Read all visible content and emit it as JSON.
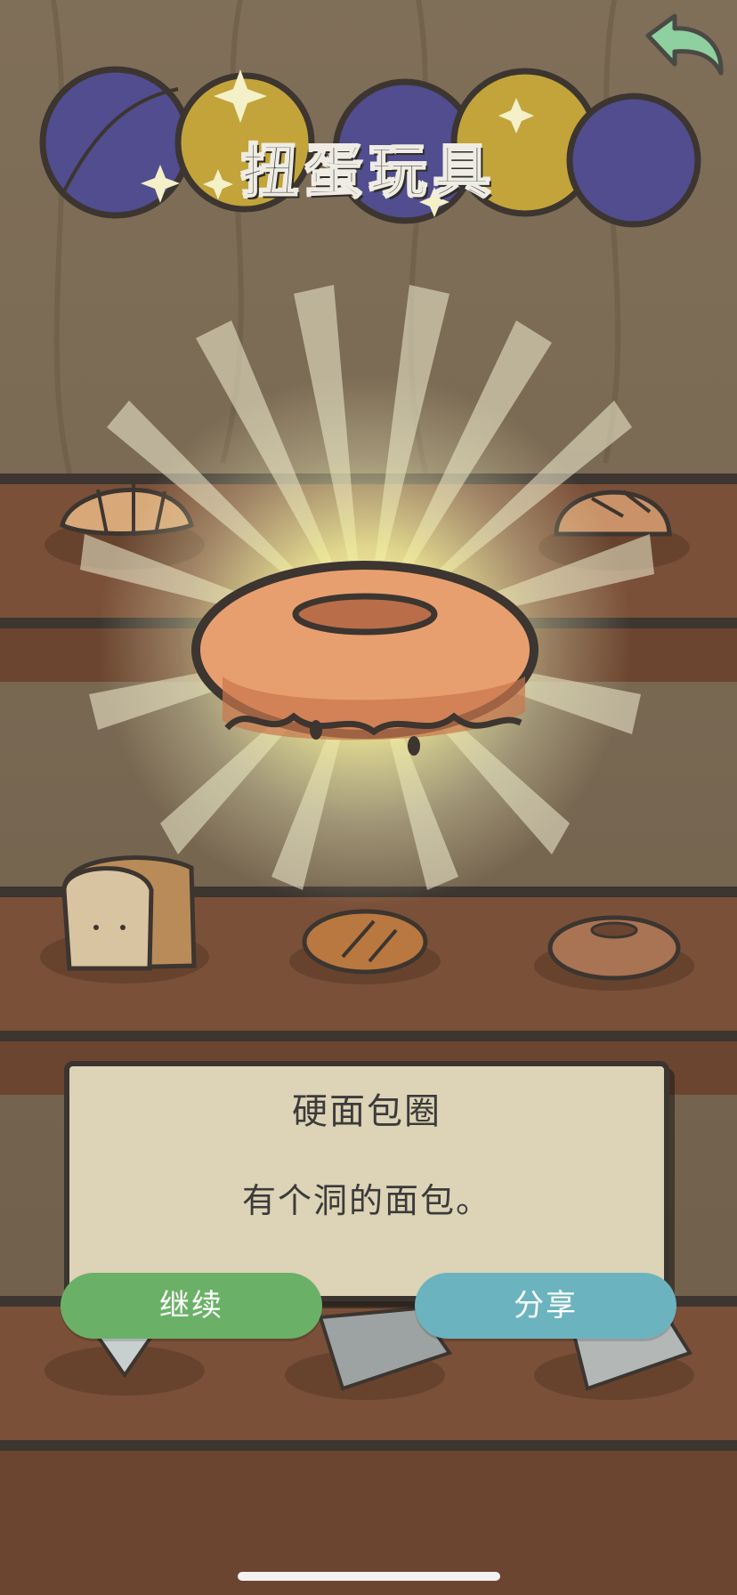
{
  "header": {
    "title": "扭蛋玩具"
  },
  "result": {
    "item_name": "硬面包圈",
    "item_description": "有个洞的面包。"
  },
  "actions": {
    "continue_label": "继续",
    "share_label": "分享"
  },
  "icons": {
    "back": "back-arrow-icon",
    "featured": "bagel-icon"
  },
  "colors": {
    "continue_button": "#6ab167",
    "share_button": "#6bb4bf",
    "card_background": "#ddd3b6",
    "back_arrow": "#8fd0a0"
  }
}
